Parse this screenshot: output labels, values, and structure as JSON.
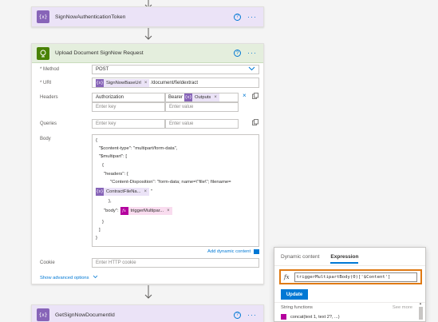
{
  "cards": {
    "auth_token": {
      "title": "SignNowAuthenticationToken"
    },
    "upload": {
      "title": "Upload Document SignNow Request"
    },
    "get_doc_id": {
      "title": "GetSignNowDocumentId"
    }
  },
  "upload_form": {
    "method_label": "* Method",
    "method_value": "POST",
    "uri_label": "* URI",
    "uri_token": "SignNowBaseUrl",
    "uri_suffix": "/document/fieldextract",
    "headers_label": "Headers",
    "header_key_1": "Authorization",
    "header_value_prefix": "Bearer",
    "header_value_token": "Outputs",
    "header_key_placeholder": "Enter key",
    "header_value_placeholder": "Enter value",
    "queries_label": "Queries",
    "query_key_placeholder": "Enter key",
    "query_value_placeholder": "Enter value",
    "body_label": "Body",
    "body_lines": {
      "l1": "{",
      "l2": "\"$content-type\": \"multipart/form-data\",",
      "l3": "\"$multipart\": [",
      "l4": "{",
      "l5": "\"headers\": {",
      "l6": "\"Content-Disposition\": \"form-data; name=\\\"file\\\"; filename=",
      "l6_token": "ContractFileNa...",
      "l6_tail": "\"",
      "l7": "},",
      "l8_prefix": "\"body\":",
      "l8_token": "triggerMultipar...",
      "l9": "}",
      "l10": "]",
      "l11": "}"
    },
    "add_dynamic_content": "Add dynamic content",
    "cookie_label": "Cookie",
    "cookie_placeholder": "Enter HTTP cookie",
    "show_advanced": "Show advanced options"
  },
  "expression_panel": {
    "tab_dynamic": "Dynamic content",
    "tab_expression": "Expression",
    "expression_value": "triggerMultipartBody(0)['$Content']",
    "update_label": "Update",
    "section_title": "String functions",
    "see_more": "See more",
    "function_row": "concat(text 1, text 2?, ...)"
  },
  "colors": {
    "accent": "#0078d4",
    "purple_action": "#8764b8",
    "green_action": "#498205",
    "expression_token": "#b4009e",
    "highlight_border": "#e07a14"
  },
  "icons": {
    "variable": "{x}",
    "fx": "fx",
    "help": "?",
    "more": "···",
    "http": "globe-icon",
    "delete": "×",
    "copy": "copy-icon",
    "chevron": "chevron-down-icon"
  }
}
